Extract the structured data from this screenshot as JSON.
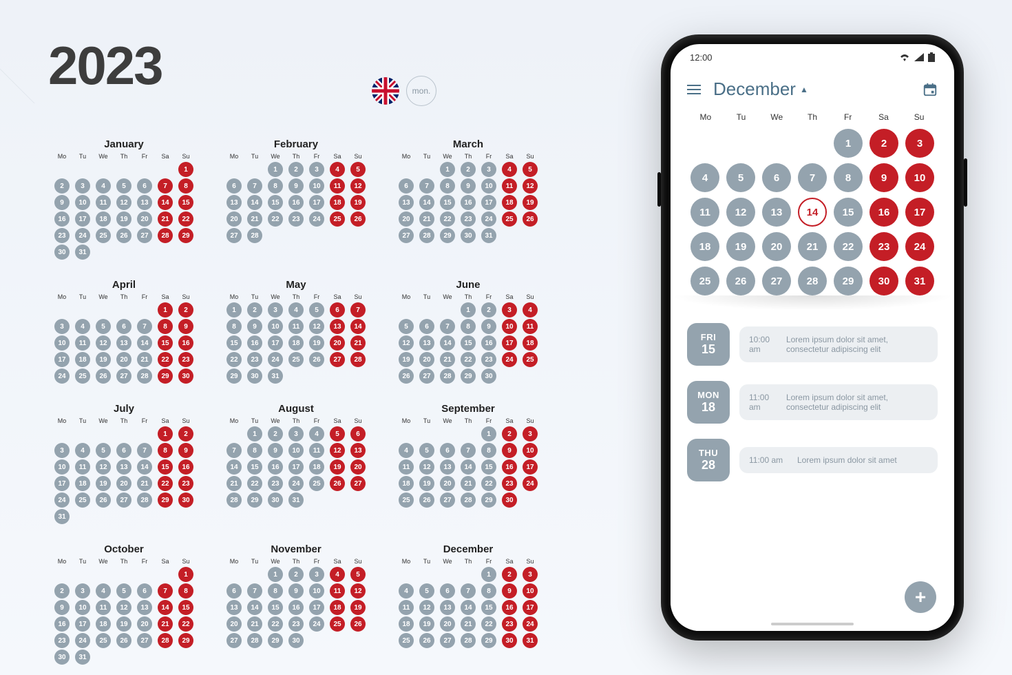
{
  "year": "2023",
  "mon_label": "mon.",
  "dow": [
    "Mo",
    "Tu",
    "We",
    "Th",
    "Fr",
    "Sa",
    "Su"
  ],
  "months": [
    {
      "name": "January",
      "start": 6,
      "days": 31
    },
    {
      "name": "February",
      "start": 2,
      "days": 28
    },
    {
      "name": "March",
      "start": 2,
      "days": 31
    },
    {
      "name": "April",
      "start": 5,
      "days": 30
    },
    {
      "name": "May",
      "start": 0,
      "days": 31
    },
    {
      "name": "June",
      "start": 3,
      "days": 30
    },
    {
      "name": "July",
      "start": 5,
      "days": 31
    },
    {
      "name": "August",
      "start": 1,
      "days": 31
    },
    {
      "name": "September",
      "start": 4,
      "days": 30
    },
    {
      "name": "October",
      "start": 6,
      "days": 31
    },
    {
      "name": "November",
      "start": 2,
      "days": 30
    },
    {
      "name": "December",
      "start": 4,
      "days": 31
    }
  ],
  "phone": {
    "time": "12:00",
    "month_label": "December",
    "dow": [
      "Mo",
      "Tu",
      "We",
      "Th",
      "Fr",
      "Sa",
      "Su"
    ],
    "today": 14,
    "start": 4,
    "days": 31,
    "events": [
      {
        "dw": "FRI",
        "dn": "15",
        "time": "10:00 am",
        "text": "Lorem ipsum dolor sit amet, consectetur adipiscing elit"
      },
      {
        "dw": "MON",
        "dn": "18",
        "time": "11:00 am",
        "text": "Lorem ipsum dolor sit amet, consectetur adipiscing elit"
      },
      {
        "dw": "THU",
        "dn": "28",
        "time": "11:00 am",
        "text": "Lorem ipsum dolor sit amet"
      }
    ]
  }
}
